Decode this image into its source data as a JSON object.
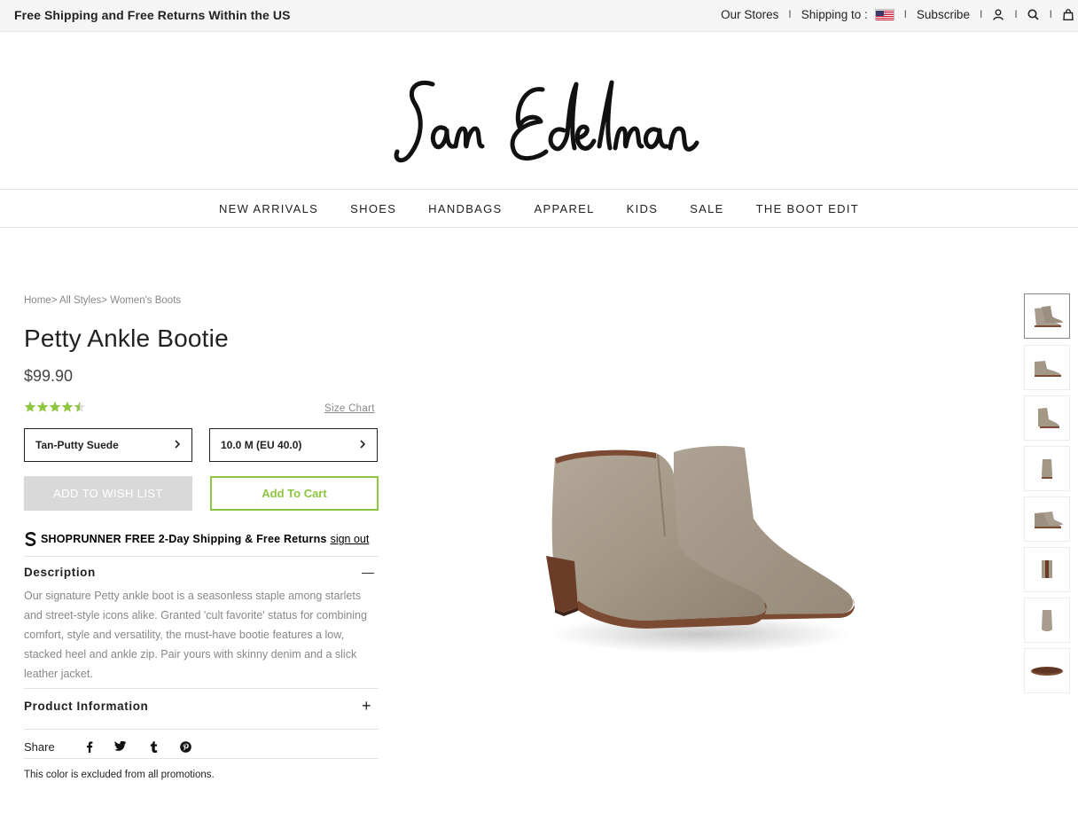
{
  "topbar": {
    "promo": "Free Shipping and Free Returns Within the US",
    "our_stores": "Our Stores",
    "shipping_to": "Shipping to :",
    "subscribe": "Subscribe",
    "separator": "I"
  },
  "brand": {
    "logo_text": "Sam Edelman"
  },
  "nav": {
    "items": [
      "NEW ARRIVALS",
      "SHOES",
      "HANDBAGS",
      "APPAREL",
      "KIDS",
      "SALE",
      "THE BOOT EDIT"
    ]
  },
  "breadcrumb": {
    "items": [
      "Home",
      "All Styles",
      "Women's Boots"
    ],
    "separator": ">"
  },
  "product": {
    "title": "Petty Ankle Bootie",
    "price": "$99.90",
    "rating": 4.5,
    "rating_max": 5,
    "size_chart": "Size Chart",
    "color_value": "Tan-Putty Suede",
    "size_value": "10.0 M (EU 40.0)",
    "wish_list_label": "ADD TO WISH LIST",
    "add_to_cart_label": "Add To Cart"
  },
  "shoprunner": {
    "brand": "SHOPRUNNER",
    "offer": "FREE 2-Day Shipping & Free Returns",
    "signout": "sign out"
  },
  "description": {
    "heading": "Description",
    "toggle": "—",
    "body": "Our signature Petty ankle boot is a seasonless staple among starlets and street-style icons alike. Granted 'cult favorite' status for combining comfort, style and versatility, the must-have bootie features a low, stacked heel and ankle zip. Pair yours with skinny denim and a slick leather jacket."
  },
  "product_info": {
    "heading": "Product Information",
    "toggle": "+"
  },
  "share": {
    "label": "Share",
    "networks": [
      "facebook-icon",
      "twitter-icon",
      "tumblr-icon",
      "pinterest-icon"
    ]
  },
  "promo_note": "This color is excluded from all promotions.",
  "colors": {
    "accent_green": "#8dc63f",
    "star_green": "#8dc63f",
    "suede": "#a89c8e",
    "sole": "#7a4a32"
  },
  "thumbnails": {
    "count": 8,
    "active_index": 0
  }
}
